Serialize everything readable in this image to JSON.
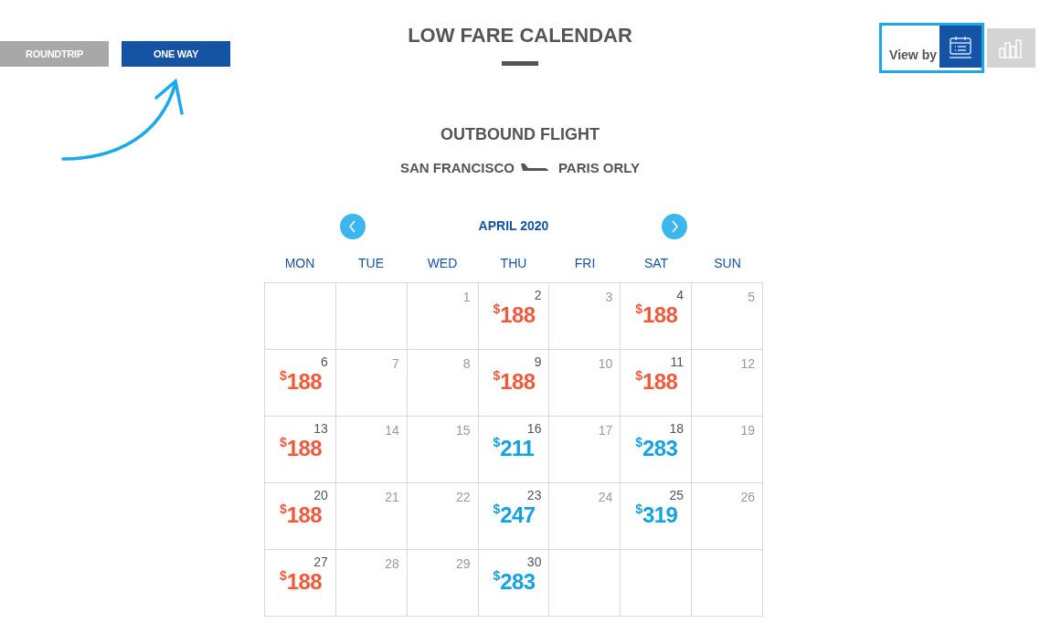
{
  "trip_types": [
    {
      "label": "ROUNDTRIP",
      "selected": false
    },
    {
      "label": "ONE WAY",
      "selected": true
    }
  ],
  "title": "LOW FARE CALENDAR",
  "view_by": {
    "label": "View by",
    "options": [
      {
        "kind": "calendar",
        "selected": true
      },
      {
        "kind": "chart",
        "selected": false
      }
    ]
  },
  "section_title": "OUTBOUND FLIGHT",
  "route": {
    "from": "SAN FRANCISCO",
    "to": "PARIS ORLY"
  },
  "month": "APRIL 2020",
  "weekdays": [
    "MON",
    "TUE",
    "WED",
    "THU",
    "FRI",
    "SAT",
    "SUN"
  ],
  "weeks": [
    [
      {
        "kind": "empty"
      },
      {
        "kind": "empty"
      },
      {
        "kind": "day",
        "day": "1"
      },
      {
        "kind": "fare",
        "day": "2",
        "currency": "$",
        "amount": "188",
        "color": "#ef5a3c"
      },
      {
        "kind": "day",
        "day": "3"
      },
      {
        "kind": "fare",
        "day": "4",
        "currency": "$",
        "amount": "188",
        "color": "#ef5a3c"
      },
      {
        "kind": "day",
        "day": "5"
      }
    ],
    [
      {
        "kind": "fare",
        "day": "6",
        "currency": "$",
        "amount": "188",
        "color": "#ef5a3c"
      },
      {
        "kind": "day",
        "day": "7"
      },
      {
        "kind": "day",
        "day": "8"
      },
      {
        "kind": "fare",
        "day": "9",
        "currency": "$",
        "amount": "188",
        "color": "#ef5a3c"
      },
      {
        "kind": "day",
        "day": "10"
      },
      {
        "kind": "fare",
        "day": "11",
        "currency": "$",
        "amount": "188",
        "color": "#ef5a3c"
      },
      {
        "kind": "day",
        "day": "12"
      }
    ],
    [
      {
        "kind": "fare",
        "day": "13",
        "currency": "$",
        "amount": "188",
        "color": "#ef5a3c"
      },
      {
        "kind": "day",
        "day": "14"
      },
      {
        "kind": "day",
        "day": "15"
      },
      {
        "kind": "fare",
        "day": "16",
        "currency": "$",
        "amount": "211",
        "color": "#12a3e0"
      },
      {
        "kind": "day",
        "day": "17"
      },
      {
        "kind": "fare",
        "day": "18",
        "currency": "$",
        "amount": "283",
        "color": "#12a3e0"
      },
      {
        "kind": "day",
        "day": "19"
      }
    ],
    [
      {
        "kind": "fare",
        "day": "20",
        "currency": "$",
        "amount": "188",
        "color": "#ef5a3c"
      },
      {
        "kind": "day",
        "day": "21"
      },
      {
        "kind": "day",
        "day": "22"
      },
      {
        "kind": "fare",
        "day": "23",
        "currency": "$",
        "amount": "247",
        "color": "#12a3e0"
      },
      {
        "kind": "day",
        "day": "24"
      },
      {
        "kind": "fare",
        "day": "25",
        "currency": "$",
        "amount": "319",
        "color": "#12a3e0"
      },
      {
        "kind": "day",
        "day": "26"
      }
    ],
    [
      {
        "kind": "fare",
        "day": "27",
        "currency": "$",
        "amount": "188",
        "color": "#ef5a3c"
      },
      {
        "kind": "day",
        "day": "28"
      },
      {
        "kind": "day",
        "day": "29"
      },
      {
        "kind": "fare",
        "day": "30",
        "currency": "$",
        "amount": "283",
        "color": "#12a3e0"
      },
      {
        "kind": "empty"
      },
      {
        "kind": "empty"
      },
      {
        "kind": "empty"
      }
    ]
  ]
}
